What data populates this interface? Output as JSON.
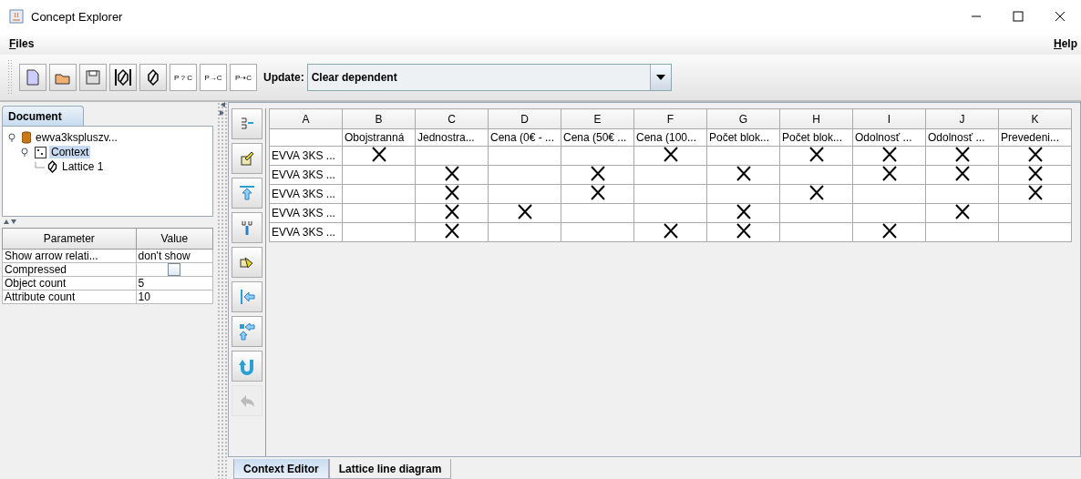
{
  "window": {
    "title": "Concept Explorer"
  },
  "menu": {
    "left": "Files",
    "right": "Help"
  },
  "toolbar": {
    "text_buttons": [
      "P ? C",
      "P→C",
      "P⇢C"
    ],
    "update_label": "Update:",
    "update_value": "Clear dependent"
  },
  "document_panel": {
    "tab": {
      "label": "Document",
      "selected": true
    },
    "tree": [
      {
        "label": "ewva3kspluszv...",
        "kind": "document",
        "expanded": true,
        "selected": false,
        "children": [
          {
            "label": "Context",
            "kind": "context",
            "expanded": true,
            "selected": true,
            "children": [
              {
                "label": "Lattice 1",
                "kind": "lattice",
                "selected": false
              }
            ]
          }
        ]
      }
    ]
  },
  "parameters": {
    "columns": [
      "Parameter",
      "Value"
    ],
    "rows": [
      {
        "name": "Show arrow relati...",
        "kind": "text",
        "value": "don't show"
      },
      {
        "name": "Compressed",
        "kind": "checkbox",
        "checked": false
      },
      {
        "name": "Object count",
        "kind": "text",
        "value": "5"
      },
      {
        "name": "Attribute count",
        "kind": "text",
        "value": "10"
      }
    ]
  },
  "context_tools": [
    {
      "disabled": false
    },
    {
      "disabled": false
    },
    {
      "disabled": false
    },
    {
      "disabled": false
    },
    {
      "disabled": false
    },
    {
      "disabled": false
    },
    {
      "disabled": false
    },
    {
      "disabled": false
    },
    {
      "disabled": true
    }
  ],
  "context_table": {
    "columns": [
      "A",
      "B",
      "C",
      "D",
      "E",
      "F",
      "G",
      "H",
      "I",
      "J",
      "K"
    ],
    "attributes": [
      "Obojstranná",
      "Jednostra...",
      "Cena (0€ - ...",
      "Cena (50€ ...",
      "Cena (100...",
      "Počet blok...",
      "Počet blok...",
      "Odolnosť ...",
      "Odolnosť ...",
      "Prevedeni..."
    ],
    "rows": [
      {
        "object": "EVVA 3KS ...",
        "crosses": [
          true,
          false,
          false,
          false,
          true,
          false,
          true,
          true,
          true,
          true
        ]
      },
      {
        "object": "EVVA 3KS ...",
        "crosses": [
          false,
          true,
          false,
          true,
          false,
          true,
          false,
          true,
          true,
          true
        ]
      },
      {
        "object": "EVVA 3KS ...",
        "crosses": [
          false,
          true,
          false,
          true,
          false,
          false,
          true,
          false,
          false,
          true
        ]
      },
      {
        "object": "EVVA 3KS ...",
        "crosses": [
          false,
          true,
          true,
          false,
          false,
          true,
          false,
          false,
          true,
          false
        ]
      },
      {
        "object": "EVVA 3KS ...",
        "crosses": [
          false,
          true,
          false,
          false,
          true,
          true,
          false,
          true,
          false,
          false
        ]
      }
    ]
  },
  "bottom_tabs": [
    {
      "label": "Context Editor",
      "selected": true
    },
    {
      "label": "Lattice line diagram",
      "selected": false
    }
  ]
}
